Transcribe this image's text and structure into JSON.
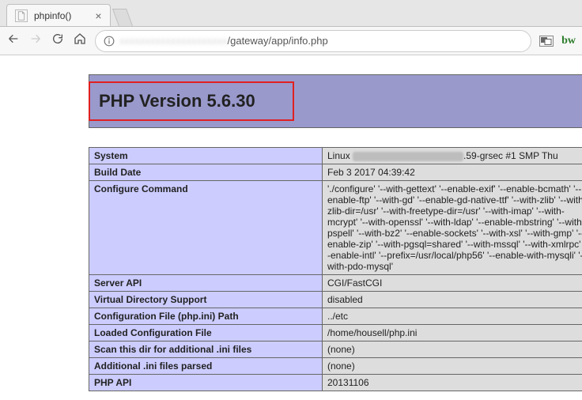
{
  "browser": {
    "tab_title": "phpinfo()",
    "url_host_blur": "xxxxxxxxxxxxxxxxxxxxx",
    "url_path": "/gateway/app/info.php"
  },
  "php_header": "PHP Version 5.6.30",
  "rows": [
    {
      "key": "System",
      "value_prefix": "Linux ",
      "value_suffix": ".59-grsec #1 SMP Thu",
      "has_blur": true
    },
    {
      "key": "Build Date",
      "value": "Feb 3 2017 04:39:42"
    },
    {
      "key": "Configure Command",
      "value": "'./configure' '--with-gettext' '--enable-exif' '--enable-bcmath' '--enable-ftp' '--with-gd' '--enable-gd-native-ttf' '--with-zlib' '--with-zlib-dir=/usr' '--with-freetype-dir=/usr' '--with-imap' '--with-mcrypt' '--with-openssl' '--with-ldap' '--enable-mbstring' '--with-pspell' '--with-bz2' '--enable-sockets' '--with-xsl' '--with-gmp' '--enable-zip' '--with-pgsql=shared' '--with-mssql' '--with-xmlrpc' '--enable-intl' '--prefix=/usr/local/php56' '--enable-with-mysqli' '--with-pdo-mysql'"
    },
    {
      "key": "Server API",
      "value": "CGI/FastCGI"
    },
    {
      "key": "Virtual Directory Support",
      "value": "disabled"
    },
    {
      "key": "Configuration File (php.ini) Path",
      "value": "../etc"
    },
    {
      "key": "Loaded Configuration File",
      "value": "/home/housell/php.ini"
    },
    {
      "key": "Scan this dir for additional .ini files",
      "value": "(none)"
    },
    {
      "key": "Additional .ini files parsed",
      "value": "(none)"
    },
    {
      "key": "PHP API",
      "value": "20131106"
    }
  ]
}
